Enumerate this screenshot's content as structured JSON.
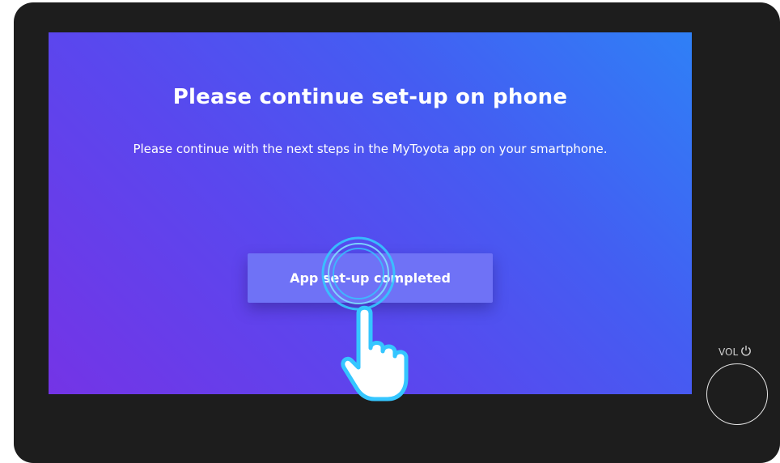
{
  "screen": {
    "title": "Please continue set-up on phone",
    "subtitle": "Please continue with the next steps in the MyToyota app on your smartphone.",
    "button_label": "App set-up completed"
  },
  "device": {
    "vol_label": "VOL",
    "power_icon": "power-icon",
    "knob_icon": "volume-knob"
  },
  "overlay": {
    "icon": "tap-hand-icon",
    "ring_color": "#35c6ff"
  },
  "colors": {
    "gradient_start": "#7434e6",
    "gradient_end": "#2f80f6",
    "button": "#6f72f6",
    "bezel": "#1d1d1d"
  }
}
